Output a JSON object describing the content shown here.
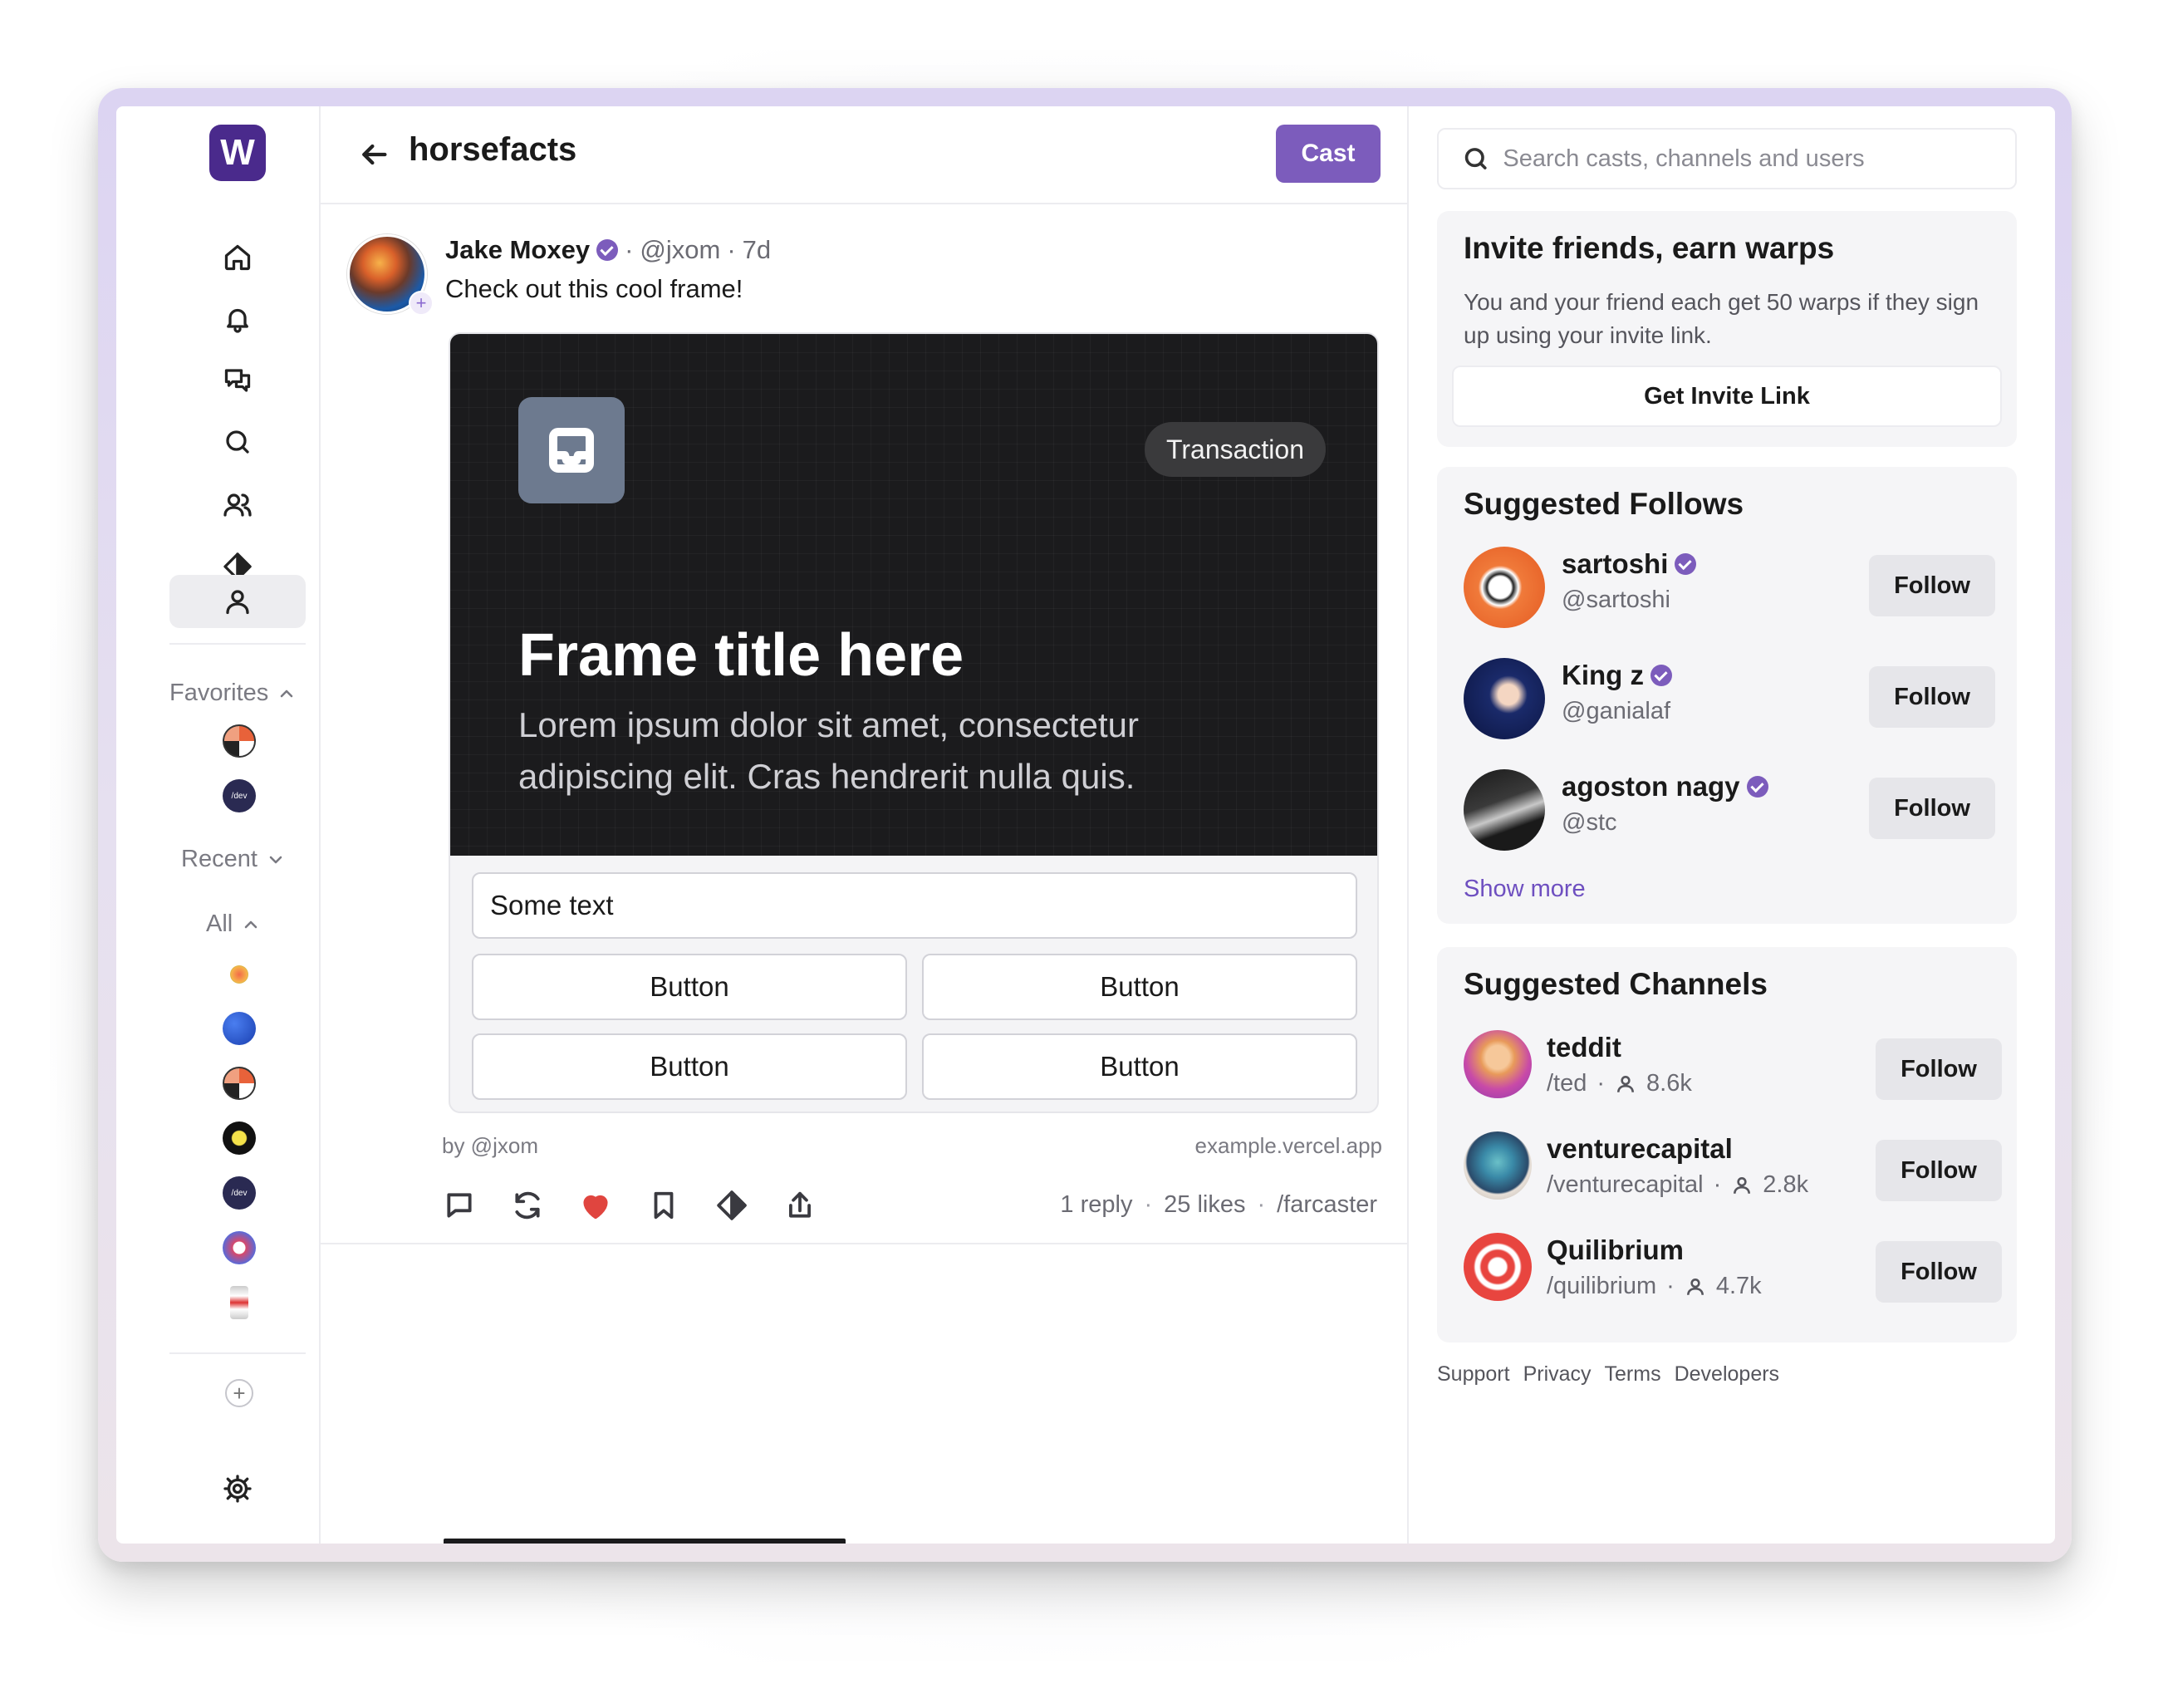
{
  "app": {
    "logo_letter": "W"
  },
  "sidebar": {
    "nav_items": [
      {
        "icon": "home-icon"
      },
      {
        "icon": "bell-icon"
      },
      {
        "icon": "chat-bubbles-icon"
      },
      {
        "icon": "search-icon"
      },
      {
        "icon": "users-icon"
      },
      {
        "icon": "diamond-icon"
      },
      {
        "icon": "user-icon",
        "active": true
      }
    ],
    "favorites_label": "Favorites",
    "recent_label": "Recent",
    "all_label": "All"
  },
  "header": {
    "channel_title": "horsefacts",
    "cast_label": "Cast"
  },
  "post": {
    "author_name": "Jake Moxey",
    "author_handle": "@jxom",
    "time_ago": "7d",
    "meta_sep": "·",
    "text": "Check out this cool frame!",
    "frame": {
      "badge": "Transaction",
      "title": "Frame title here",
      "description": "Lorem ipsum dolor sit amet, consectetur adipiscing elit. Cras hendrerit nulla quis.",
      "input_value": "Some text",
      "buttons": [
        "Button",
        "Button",
        "Button",
        "Button"
      ],
      "by_label": "by @jxom",
      "domain": "example.vercel.app"
    },
    "stats": {
      "replies": "1 reply",
      "likes": "25 likes",
      "channel": "/farcaster",
      "sep": "·"
    },
    "colors": {
      "like_active": "#e0453f"
    }
  },
  "search": {
    "placeholder": "Search casts, channels and users"
  },
  "invite": {
    "title": "Invite friends, earn warps",
    "text": "You and your friend each get 50 warps if they sign up using your invite link.",
    "button_label": "Get Invite Link"
  },
  "suggested_follows": {
    "title": "Suggested Follows",
    "users": [
      {
        "name": "sartoshi",
        "handle": "@sartoshi",
        "verified": true,
        "follow_label": "Follow"
      },
      {
        "name": "King z",
        "handle": "@ganialaf",
        "verified": true,
        "follow_label": "Follow"
      },
      {
        "name": "agoston nagy",
        "handle": "@stc",
        "verified": true,
        "follow_label": "Follow"
      }
    ],
    "show_more": "Show more"
  },
  "suggested_channels": {
    "title": "Suggested Channels",
    "sep": "·",
    "channels": [
      {
        "name": "teddit",
        "path": "/ted",
        "members": "8.6k",
        "follow_label": "Follow"
      },
      {
        "name": "venturecapital",
        "path": "/venturecapital",
        "members": "2.8k",
        "follow_label": "Follow"
      },
      {
        "name": "Quilibrium",
        "path": "/quilibrium",
        "members": "4.7k",
        "follow_label": "Follow"
      }
    ]
  },
  "footer": {
    "links": [
      "Support",
      "Privacy",
      "Terms",
      "Developers"
    ]
  },
  "theme": {
    "accent": "#7c5cbc",
    "brand": "#4a2a8c"
  }
}
